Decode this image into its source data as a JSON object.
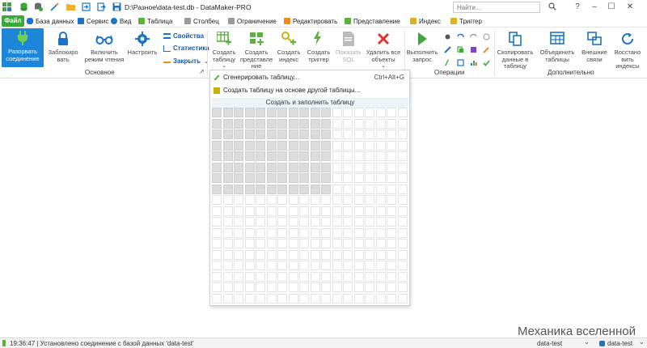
{
  "titlebar": {
    "title": "D:\\Разное\\data-test.db - DataMaker-PRO",
    "search_placeholder": "Найти...",
    "help": "?",
    "minimize": "–",
    "maximize": "☐",
    "close": "✕"
  },
  "menu": {
    "file": "Файл",
    "items": [
      "База данных",
      "Сервис",
      "Вид",
      "Таблица",
      "Столбец",
      "Ограничение",
      "Редактировать",
      "Представление",
      "Индекс",
      "Триггер"
    ],
    "help": "?"
  },
  "ribbon": {
    "disconnect": "Разорвать соединение",
    "lock": "Заблокиро вать",
    "read_mode": "Включить режим чтения",
    "configure": "Настроить",
    "properties": "Свойства",
    "statistics": "Статистика",
    "close": "Закрыть",
    "create_table": "Создать таблицу",
    "create_view": "Создать представле ние",
    "create_index": "Создать индекс",
    "create_trigger": "Создать триггер",
    "show_sql": "Показать SQL",
    "delete_all": "Удалить все объекты",
    "run_query": "Выполнить запрос",
    "copy_data": "Скопировать данные в таблицу",
    "merge_tables": "Объединить таблицы",
    "external_links": "Внешние связи",
    "restore_indexes": "Восстано вить индексы",
    "group_main": "Основное",
    "group_operations": "Операции",
    "group_extra": "Дополнительно"
  },
  "dropdown": {
    "generate": "Сгенерировать таблицу...",
    "generate_shortcut": "Ctrl+Alt+G",
    "create_from_other": "Создать таблицу на основе другой таблицы...",
    "create_fill_header": "Создать и заполнить таблицу",
    "grid": {
      "cols": 18,
      "rows": 18,
      "selected_cols": 11,
      "selected_rows": 8
    }
  },
  "status": {
    "message": "19:36:47 | Установлено соединение с базой данных 'data-test'",
    "db_left": "data-test",
    "db_right": "data-test"
  },
  "watermark": "Механика вселенной",
  "colors": {
    "accent": "#1d86d8",
    "file_green": "#3aa83a",
    "icon_green": "#5ab33a",
    "icon_blue": "#1a74c7",
    "icon_red": "#e0332a"
  }
}
